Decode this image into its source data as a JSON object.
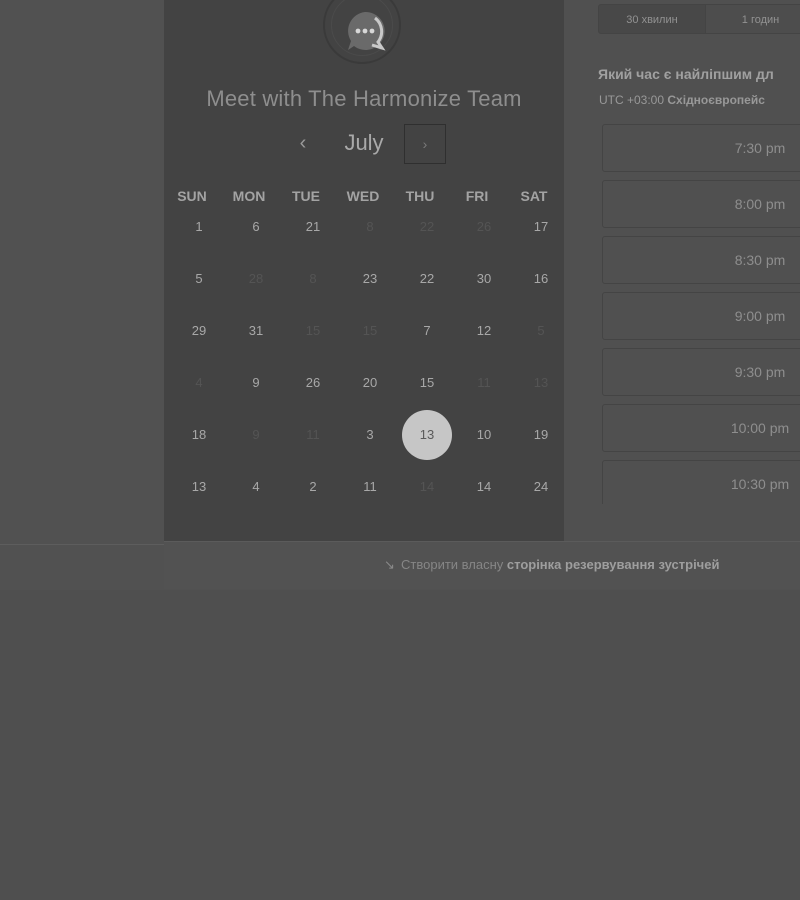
{
  "calendar": {
    "title": "Meet with The Harmonize Team",
    "month": "July",
    "prev_glyph": "‹",
    "next_glyph": "›",
    "weekdays": [
      "SUN",
      "MON",
      "TUE",
      "WED",
      "THU",
      "FRI",
      "SAT"
    ],
    "rows": [
      [
        {
          "n": "1"
        },
        {
          "n": "6"
        },
        {
          "n": "21"
        },
        {
          "n": "8",
          "dim": true
        },
        {
          "n": "22",
          "dim": true
        },
        {
          "n": "26",
          "dim": true
        },
        {
          "n": "17"
        }
      ],
      [
        {
          "n": "5"
        },
        {
          "n": "28",
          "dim": true
        },
        {
          "n": "8",
          "dim": true
        },
        {
          "n": "23"
        },
        {
          "n": "22"
        },
        {
          "n": "30"
        },
        {
          "n": "16"
        }
      ],
      [
        {
          "n": "29"
        },
        {
          "n": "31"
        },
        {
          "n": "15",
          "dim": true
        },
        {
          "n": "15",
          "dim": true
        },
        {
          "n": "7"
        },
        {
          "n": "12"
        },
        {
          "n": "5",
          "dim": true
        }
      ],
      [
        {
          "n": "4",
          "dim": true
        },
        {
          "n": "9"
        },
        {
          "n": "26"
        },
        {
          "n": "20"
        },
        {
          "n": "15"
        },
        {
          "n": "11",
          "dim": true
        },
        {
          "n": "13",
          "dim": true
        }
      ],
      [
        {
          "n": "18"
        },
        {
          "n": "9",
          "dim": true
        },
        {
          "n": "11",
          "dim": true
        },
        {
          "n": "3"
        },
        {
          "n": "13",
          "selected": true
        },
        {
          "n": "10"
        },
        {
          "n": "19"
        }
      ],
      [
        {
          "n": "13"
        },
        {
          "n": "4"
        },
        {
          "n": "2"
        },
        {
          "n": "11"
        },
        {
          "n": "14",
          "dim": true
        },
        {
          "n": "14"
        },
        {
          "n": "24"
        }
      ]
    ],
    "logo_icon": "chat-bubble-icon"
  },
  "durations": [
    "30 хвилин",
    "1 годин"
  ],
  "prompt": "Який час є найліпшим дл",
  "timezone": {
    "offset": "UTC +03:00",
    "name": "Східноєвропейс"
  },
  "slots": [
    "7:30 pm",
    "8:00 pm",
    "8:30 pm",
    "9:00 pm",
    "9:30 pm",
    "10:00 pm",
    "10:30 pm"
  ],
  "footer": {
    "icon": "pointer-arrow-icon",
    "text": "Створити власну",
    "bold": "сторінка резервування зустрічей"
  },
  "colors": {
    "selected_day": "#c6c6c6",
    "panel": "#434343",
    "background": "#4f4f4f"
  }
}
